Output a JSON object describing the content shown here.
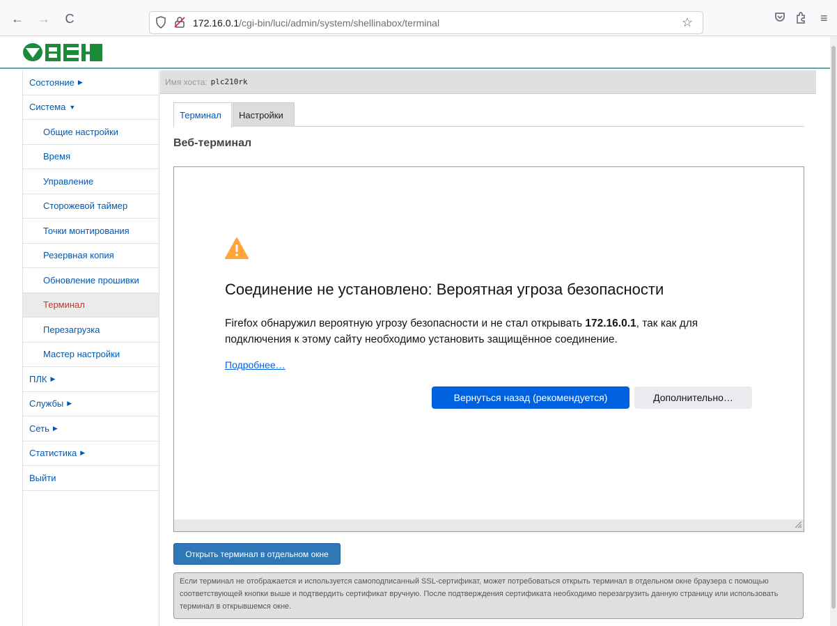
{
  "browser": {
    "back_glyph": "←",
    "forward_glyph": "→",
    "reload_glyph": "C",
    "url_host": "172.16.0.1",
    "url_path": "/cgi-bin/luci/admin/system/shellinabox/terminal"
  },
  "header": {
    "logo_text": "ОВЕН"
  },
  "sidebar": {
    "items": [
      {
        "label": "Состояние"
      },
      {
        "label": "Система"
      },
      {
        "label": "Общие настройки"
      },
      {
        "label": "Время"
      },
      {
        "label": "Управление"
      },
      {
        "label": "Сторожевой таймер"
      },
      {
        "label": "Точки монтирования"
      },
      {
        "label": "Резервная копия"
      },
      {
        "label": "Обновление прошивки"
      },
      {
        "label": "Терминал"
      },
      {
        "label": "Перезагрузка"
      },
      {
        "label": "Мастер настройки"
      },
      {
        "label": "ПЛК"
      },
      {
        "label": "Службы"
      },
      {
        "label": "Сеть"
      },
      {
        "label": "Статистика"
      },
      {
        "label": "Выйти"
      }
    ]
  },
  "hostbar": {
    "label": "Имя хоста:",
    "value": "plc210rk"
  },
  "tabs": {
    "terminal": "Терминал",
    "settings": "Настройки"
  },
  "page": {
    "title": "Веб-терминал"
  },
  "error": {
    "title": "Соединение не установлено: Вероятная угроза безопасности",
    "desc_before": "Firefox обнаружил вероятную угрозу безопасности и не стал открывать ",
    "desc_host": "172.16.0.1",
    "desc_after": ", так как для подключения к этому сайту необходимо установить защищённое соединение.",
    "learn_more": "Подробнее…",
    "back_button": "Вернуться назад (рекомендуется)",
    "advanced_button": "Дополнительно…",
    "warning_color": "#ffa436"
  },
  "actions": {
    "open_terminal": "Открыть терминал в отдельном окне"
  },
  "info": {
    "text": "Если терминал не отображается и используется самоподписанный SSL-сертификат, может потребоваться открыть терминал в отдельном окне браузера с помощью соответствующей кнопки выше и подтвердить сертификат вручную. После подтверждения сертификата необходимо перезагрузить данную страницу или использовать терминал в открывшемся окне."
  },
  "colors": {
    "accent": "#0061e0",
    "link": "#0059b3",
    "active_item": "#c0392b",
    "header_line": "#58a8a8",
    "logo": "#1d8a3a"
  }
}
